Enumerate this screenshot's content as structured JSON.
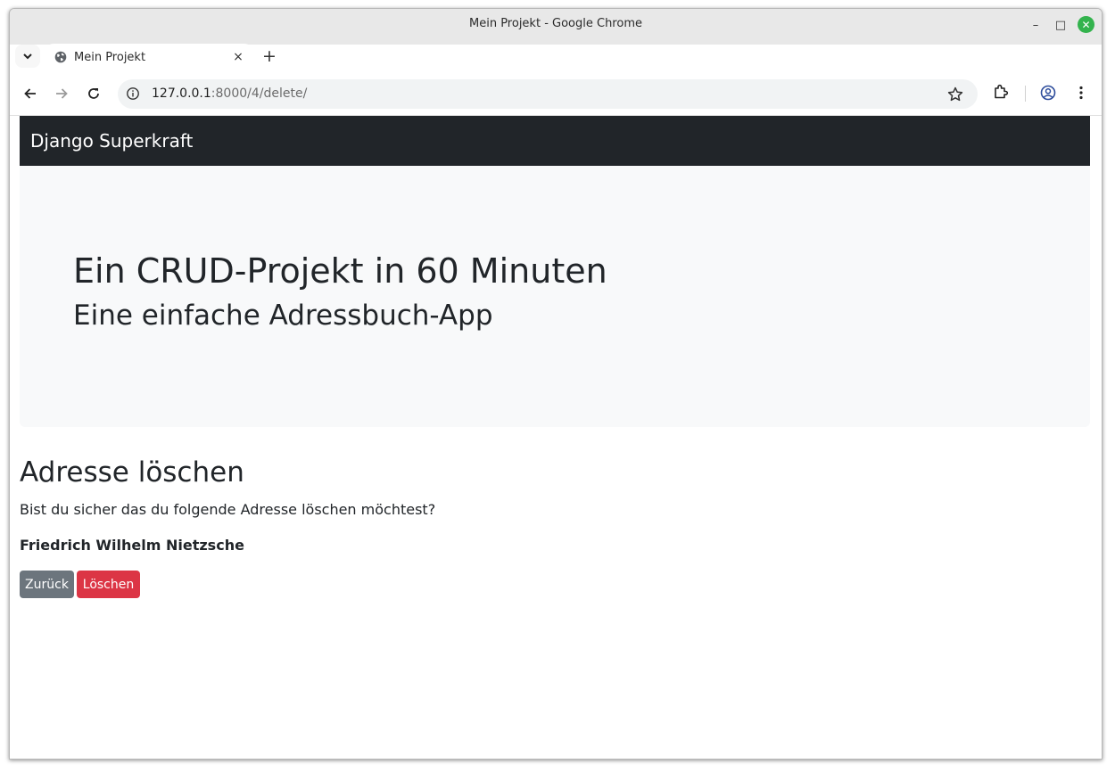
{
  "window": {
    "title": "Mein Projekt - Google Chrome",
    "minimize_label": "–",
    "maximize_label": "□",
    "close_label": "✕"
  },
  "tab": {
    "title": "Mein Projekt",
    "close_label": "×",
    "new_tab_label": "+"
  },
  "toolbar": {
    "url_host": "127.0.0.1",
    "url_path": ":8000/4/delete/"
  },
  "page": {
    "brand": "Django Superkraft",
    "jumbotron": {
      "title": "Ein CRUD-Projekt in 60 Minuten",
      "subtitle": "Eine einfache Adressbuch-App"
    },
    "section_title": "Adresse löschen",
    "question": "Bist du sicher das du folgende Adresse löschen möchtest?",
    "address_name": "Friedrich Wilhelm Nietzsche",
    "buttons": {
      "back_label": "Zurück",
      "delete_label": "Löschen"
    }
  },
  "colors": {
    "navbar": "#212529",
    "jumbotron": "#f8f9fa",
    "btn_secondary": "#6c757d",
    "btn_danger": "#dc3545",
    "window_close": "#33b34d"
  },
  "icons": [
    "tab-expand-icon",
    "globe-icon",
    "back-icon",
    "forward-icon",
    "reload-icon",
    "info-icon",
    "star-icon",
    "extensions-icon",
    "profile-icon",
    "menu-icon"
  ]
}
